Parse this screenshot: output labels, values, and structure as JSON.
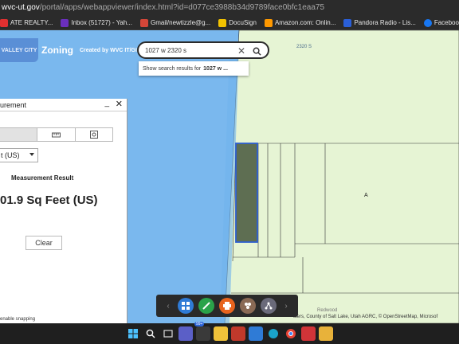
{
  "browser": {
    "url_host": "wvc-ut.gov",
    "url_path": "/portal/apps/webappviewer/index.html?id=d077ce3988b34d9789face0bfc1eaa75"
  },
  "bookmarks": [
    {
      "label": "ATE REALTY...",
      "icon": "bookmark-icon",
      "color": "#e03030"
    },
    {
      "label": "Inbox (51727) - Yah...",
      "icon": "yahoo-icon",
      "color": "#6b2fbf"
    },
    {
      "label": "Gmail/newtizzle@g...",
      "icon": "gmail-icon",
      "color": "#d44638"
    },
    {
      "label": "DocuSign",
      "icon": "docusign-icon",
      "color": "#f2c200"
    },
    {
      "label": "Amazon.com: Onlin...",
      "icon": "amazon-icon",
      "color": "#ff9900"
    },
    {
      "label": "Pandora Radio - Lis...",
      "icon": "pandora-icon",
      "color": "#2a5fd8"
    },
    {
      "label": "Facebook",
      "icon": "facebook-icon",
      "color": "#1877f2"
    }
  ],
  "app": {
    "logo_text": "VALLEY CITY",
    "title": "Zoning",
    "subtitle": "Created by WVC IT/GIS"
  },
  "search": {
    "value": "1027 w 2320 s",
    "suggestion_prefix": "Show search results for",
    "suggestion_bold": "1027 w ..."
  },
  "map": {
    "street_label": "2320 S",
    "parcel_label": "A",
    "redwood_label": "Redwood",
    "attribution": "sters, County of Salt Lake, Utah AGRC, © OpenStreetMap, Microsof"
  },
  "measurement": {
    "title": "urement",
    "unit": "t (US)",
    "result_label": "Measurement Result",
    "result_value": "01.9 Sq Feet (US)",
    "clear_label": "Clear",
    "snap_text": "enable snapping"
  },
  "taskbar": {
    "badge": "99+"
  },
  "colors": {
    "water_blue": "#7ab8ee",
    "parcel_green": "#e6f4d4",
    "selected_parcel": "#5e6e52",
    "selection_outline": "#2d5fd0"
  }
}
